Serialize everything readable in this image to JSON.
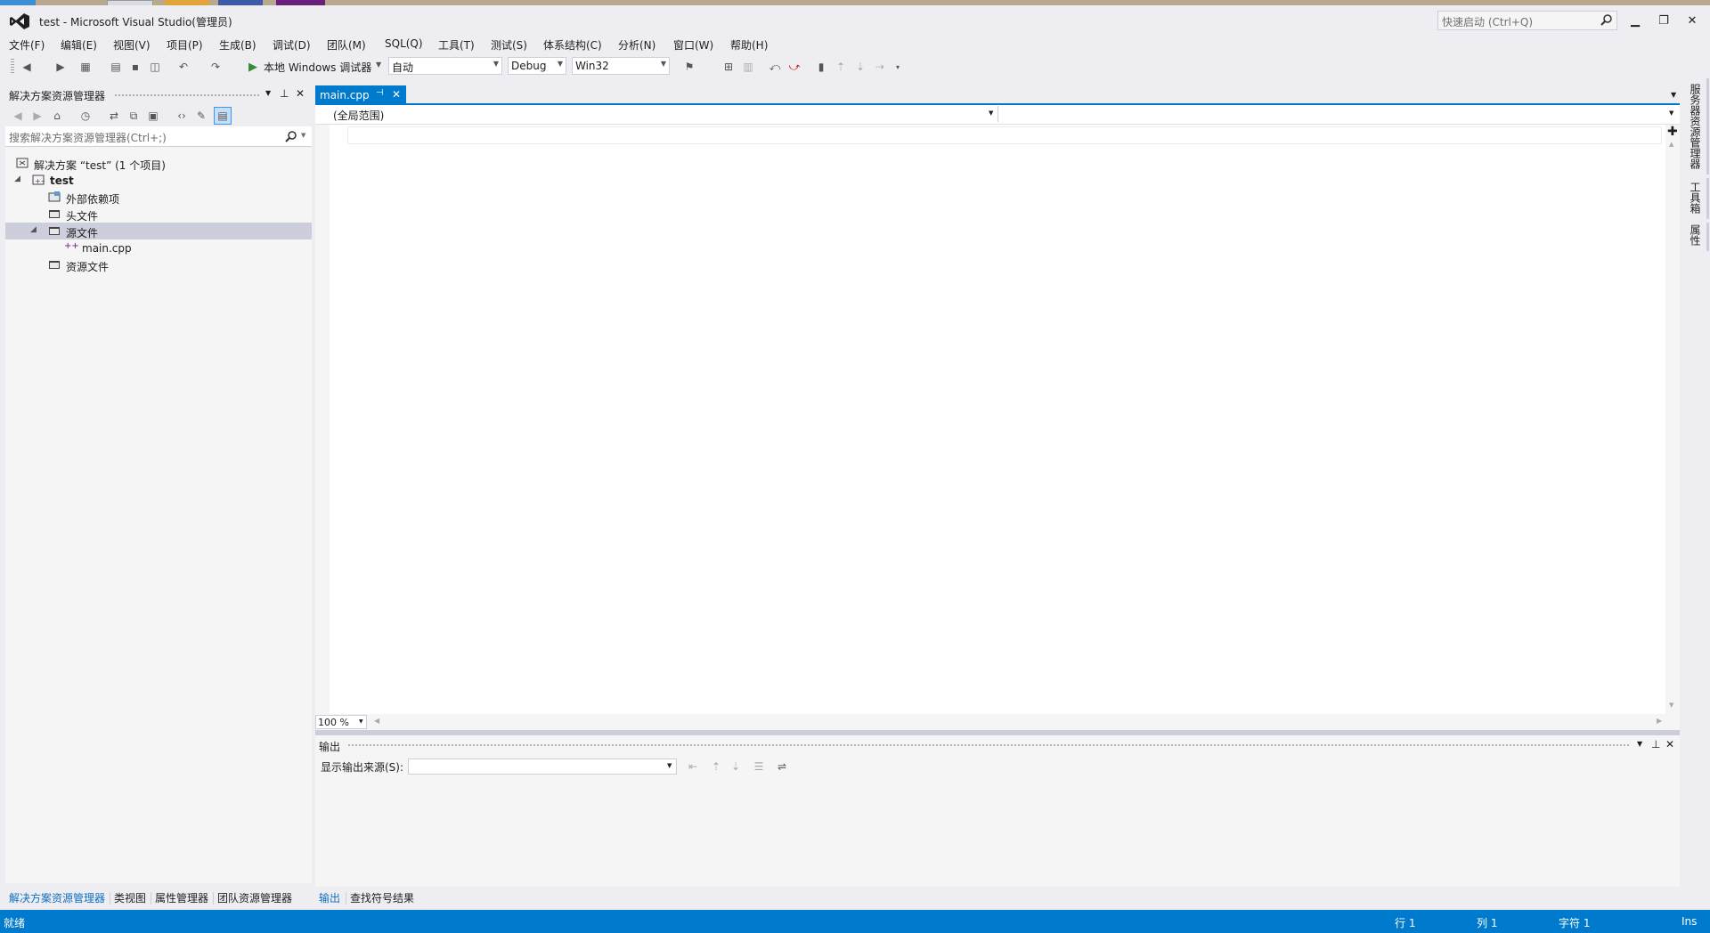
{
  "window": {
    "title": "test - Microsoft Visual Studio(管理员)",
    "quick_launch_placeholder": "快速启动 (Ctrl+Q)"
  },
  "menu": [
    "文件(F)",
    "编辑(E)",
    "视图(V)",
    "项目(P)",
    "生成(B)",
    "调试(D)",
    "团队(M)",
    "SQL(Q)",
    "工具(T)",
    "测试(S)",
    "体系结构(C)",
    "分析(N)",
    "窗口(W)",
    "帮助(H)"
  ],
  "toolbar": {
    "debugger_label": "本地 Windows 调试器",
    "config_auto": "自动",
    "config_debug": "Debug",
    "platform": "Win32"
  },
  "solution_explorer": {
    "title": "解决方案资源管理器",
    "search_placeholder": "搜索解决方案资源管理器(Ctrl+;)",
    "tree": {
      "solution": "解决方案 “test” (1 个项目)",
      "project": "test",
      "external_deps": "外部依赖项",
      "headers": "头文件",
      "sources": "源文件",
      "main_cpp": "main.cpp",
      "resources": "资源文件"
    },
    "bottom_tabs": [
      "解决方案资源管理器",
      "类视图",
      "属性管理器",
      "团队资源管理器"
    ]
  },
  "editor": {
    "tab_label": "main.cpp",
    "scope": "(全局范围)",
    "zoom": "100 %"
  },
  "output": {
    "title": "输出",
    "source_label": "显示输出来源(S):",
    "bottom_tabs": [
      "输出",
      "查找符号结果"
    ]
  },
  "right_rail": [
    "服务器资源管理器",
    "工具箱",
    "属性"
  ],
  "status": {
    "ready": "就绪",
    "line": "行 1",
    "col": "列 1",
    "char": "字符 1",
    "mode": "Ins"
  },
  "colors": {
    "accent": "#007ACC",
    "background": "#EEEEF2",
    "selection": "#CCCEDB",
    "vs_purple": "#68217A"
  }
}
